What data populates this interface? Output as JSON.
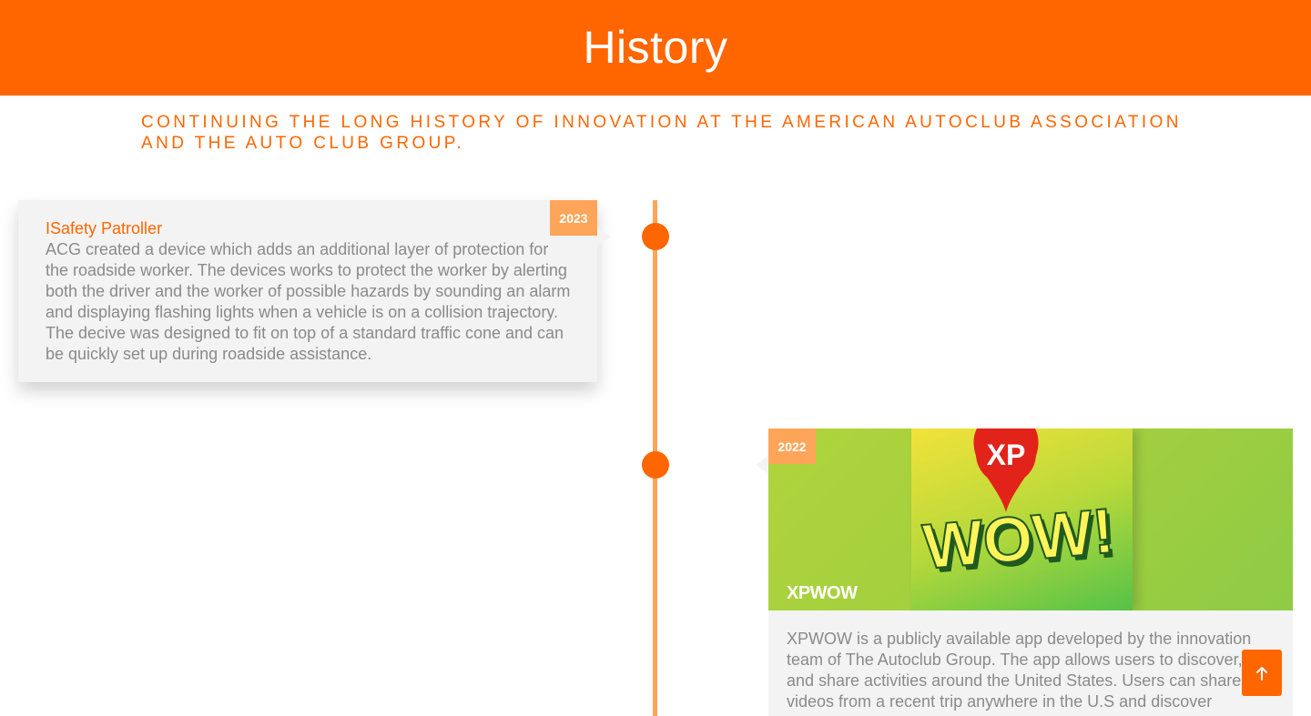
{
  "header": {
    "title": "History"
  },
  "subtitle": "Continuing the long history of innovation at the American Autoclub Association and the Auto Club Group.",
  "timeline": {
    "items": [
      {
        "year": "2023",
        "title": "ISafety Patroller",
        "text": "ACG created a device which adds an additional layer of protection for the roadside worker. The devices works to protect the worker by alerting both the driver and the worker of possible hazards by sounding an alarm and displaying flashing lights when a vehicle is on a collision trajectory. The decive was designed to fit on top of a standard traffic cone and can be quickly set up during roadside assistance."
      },
      {
        "year": "2022",
        "title": "XPWOW",
        "logo_text": "WOW!",
        "logo_pin_text": "XP",
        "text": "XPWOW is a publicly available app developed by the innovation team of The Autoclub Group.  The app allows users to discover, plan and share activities around the United States. Users can share videos from a recent trip anywhere in the U.S and discover"
      }
    ]
  },
  "colors": {
    "accent": "#ff6600",
    "accent_light": "#ffa559",
    "card_bg": "#f3f3f3",
    "body_text": "#8a8a8a"
  },
  "scroll_top": {
    "icon": "arrow-up-icon"
  }
}
